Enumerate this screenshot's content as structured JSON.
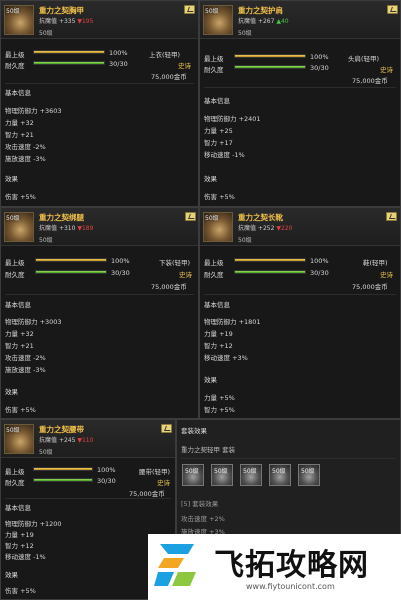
{
  "panels": {
    "p1": {
      "level_tag": "50级",
      "name": "重力之契胸甲",
      "stat_label": "抗魔值",
      "stat_base": "+335",
      "stat_diff": "▼195",
      "level": "50级",
      "max_label": "最上级",
      "max_pct": "100%",
      "max_fraction": 1.0,
      "dur_label": "耐久度",
      "dur_value": "30/30",
      "dur_fraction": 1.0,
      "slot": "上衣(轻甲)",
      "rarity": "史诗",
      "price": "75,000金币",
      "basic_title": "基本信息",
      "attrs": [
        "物理防御力 +3603",
        "力量 +32",
        "智力 +21",
        "攻击速度 -2%",
        "施放速度 -3%"
      ],
      "effect_title": "效果",
      "effects": [
        "伤害 +5%"
      ]
    },
    "p2": {
      "level_tag": "50级",
      "name": "重力之契护肩",
      "stat_label": "抗魔值",
      "stat_base": "+267",
      "stat_diff": "▲40",
      "level": "50级",
      "max_label": "最上级",
      "max_pct": "100%",
      "max_fraction": 1.0,
      "dur_label": "耐久度",
      "dur_value": "30/30",
      "dur_fraction": 1.0,
      "slot": "头肩(轻甲)",
      "rarity": "史诗",
      "price": "75,000金币",
      "basic_title": "基本信息",
      "attrs": [
        "物理防御力 +2401",
        "力量 +25",
        "智力 +17",
        "移动速度 -1%"
      ],
      "effect_title": "效果",
      "effects": [
        "伤害 +5%"
      ]
    },
    "p3": {
      "level_tag": "50级",
      "name": "重力之契绑腿",
      "stat_label": "抗魔值",
      "stat_base": "+310",
      "stat_diff": "▼189",
      "level": "50级",
      "max_label": "最上级",
      "max_pct": "100%",
      "max_fraction": 1.0,
      "dur_label": "耐久度",
      "dur_value": "30/30",
      "dur_fraction": 1.0,
      "slot": "下装(轻甲)",
      "rarity": "史诗",
      "price": "75,000金币",
      "basic_title": "基本信息",
      "attrs": [
        "物理防御力 +3003",
        "力量 +32",
        "智力 +21",
        "攻击速度 -2%",
        "施放速度 -3%"
      ],
      "effect_title": "效果",
      "effects": [
        "伤害 +5%"
      ]
    },
    "p4": {
      "level_tag": "50级",
      "name": "重力之契长靴",
      "stat_label": "抗魔值",
      "stat_base": "+252",
      "stat_diff": "▼220",
      "level": "50级",
      "max_label": "最上级",
      "max_pct": "100%",
      "max_fraction": 1.0,
      "dur_label": "耐久度",
      "dur_value": "30/30",
      "dur_fraction": 1.0,
      "slot": "鞋(轻甲)",
      "rarity": "史诗",
      "price": "75,000金币",
      "basic_title": "基本信息",
      "attrs": [
        "物理防御力 +1801",
        "力量 +19",
        "智力 +12",
        "移动速度 +3%"
      ],
      "effect_title": "效果",
      "effects": [
        "力量 +5%",
        "智力 +5%"
      ]
    },
    "p5": {
      "level_tag": "50级",
      "name": "重力之契腰带",
      "stat_label": "抗魔值",
      "stat_base": "+245",
      "stat_diff": "▼110",
      "level": "50级",
      "max_label": "最上级",
      "max_pct": "100%",
      "max_fraction": 1.0,
      "dur_label": "耐久度",
      "dur_value": "30/30",
      "dur_fraction": 1.0,
      "slot": "腰带(轻甲)",
      "rarity": "史诗",
      "price": "75,000金币",
      "basic_title": "基本信息",
      "attrs": [
        "物理防御力 +1200",
        "力量 +19",
        "智力 +12",
        "移动速度 -1%"
      ],
      "effect_title": "效果",
      "effects": [
        "伤害 +5%"
      ]
    }
  },
  "set_panel": {
    "title": "套装效果",
    "set_name": "重力之契轻甲 套装",
    "icons": [
      "50级",
      "50级",
      "50级",
      "50级",
      "50级"
    ],
    "bonus_title": "[5] 套装效果",
    "bonuses": [
      "攻击速度 +2%",
      "施放速度 +3%"
    ]
  },
  "watermark": {
    "title": "飞拓攻略网",
    "url": "www.fiytounicont.com"
  },
  "colors": {
    "name": "#f2c04a",
    "rarity": "#e8c24a",
    "up": "#48c448",
    "down": "#e04040",
    "bar_gold": "#e4b33a",
    "bar_green": "#6cc43a"
  }
}
